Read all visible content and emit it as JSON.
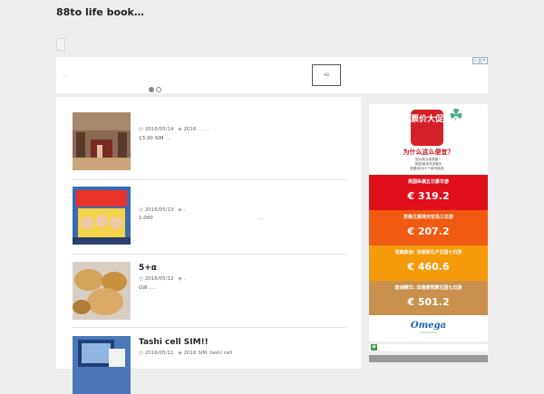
{
  "site": {
    "title": "88to life book…"
  },
  "ad": {
    "caption_dots": ".          .",
    "box_label": "AD",
    "choices": [
      "▷",
      "✕"
    ]
  },
  "posts": [
    {
      "date": "2016/05/14",
      "tags": "2016 . . . .",
      "excerpt": "13:30 SIM …",
      "title": ""
    },
    {
      "date": "2016/05/13",
      "tags": ".",
      "excerpt": "1,000",
      "excerpt2": "…",
      "title": ""
    },
    {
      "date": "2016/05/12",
      "tags": ".",
      "excerpt": "GW …",
      "title": "5+α"
    },
    {
      "date": "2016/05/11",
      "tags": "2016 SIM, tashi cell",
      "excerpt": "",
      "title": "Tashi cell SIM!!"
    }
  ],
  "icons": {
    "date": "clock-icon",
    "tag": "tag-icon",
    "rss": "rss-icon",
    "menu": "menu-icon"
  },
  "sidebar": {
    "promo": {
      "badge": "票价大促",
      "question": "为什么这么便宜？",
      "lines": [
        "因为是当地参团！",
        "英国/欧洲非游客乐",
        "英国/欧洲十个城市挑选。"
      ]
    },
    "prices": [
      {
        "name": "英国纵横五日豪华游",
        "value": "€ 319.2",
        "color": "#e0101b"
      },
      {
        "name": "苏格兰高地天空岛三日游",
        "value": "€ 207.2",
        "color": "#f05a12"
      },
      {
        "name": "经典欧洲: 法德荷比卢五国七日游",
        "value": "€ 460.6",
        "color": "#f59a0a"
      },
      {
        "name": "欧洲精华: 法瑞意梵摩五国七日游",
        "value": "€ 501.2",
        "color": "#c9914d"
      }
    ],
    "brand": {
      "name": "Omega",
      "tagline": "Travel Group"
    }
  }
}
